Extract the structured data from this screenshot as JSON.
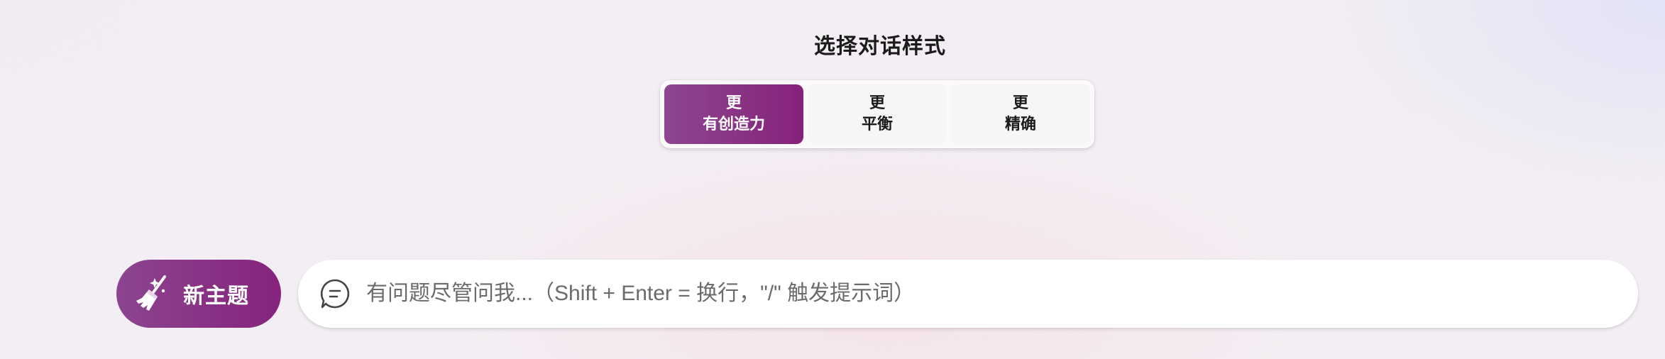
{
  "style_selector": {
    "title": "选择对话样式",
    "options": [
      {
        "line1": "更",
        "line2": "有创造力",
        "active": true
      },
      {
        "line1": "更",
        "line2": "平衡",
        "active": false
      },
      {
        "line1": "更",
        "line2": "精确",
        "active": false
      }
    ]
  },
  "new_topic": {
    "label": "新主题",
    "icon": "broom-icon"
  },
  "chat_input": {
    "icon": "chat-bubble-icon",
    "placeholder": "有问题尽管问我...（Shift + Enter = 换行，\"/\" 触发提示词）",
    "value": ""
  },
  "colors": {
    "accent_start": "#8d4690",
    "accent_end": "#86227a"
  }
}
